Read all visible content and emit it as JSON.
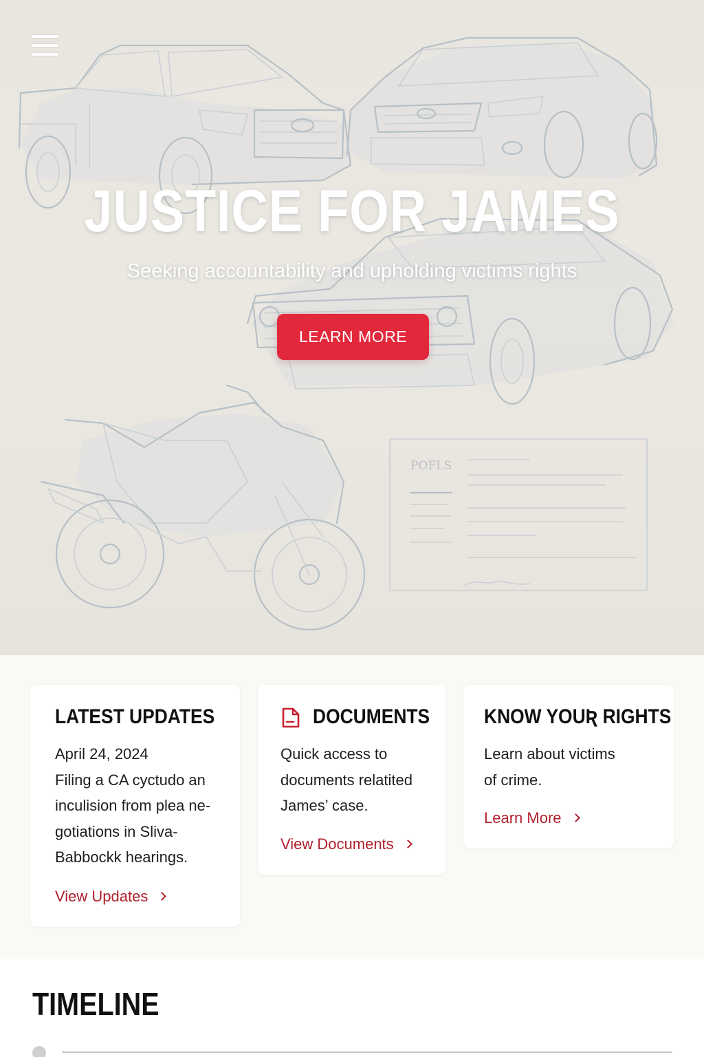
{
  "hero": {
    "title": "JUSTICE FOR JAMES",
    "subtitle": "Seeking accountability and upholding victims rights",
    "cta_label": "LEARN MORE",
    "doc_sketch_text": "POFLS"
  },
  "cards": {
    "updates": {
      "title": "LATEST UPDATES",
      "date": "April 24, 2024",
      "body": [
        "Filing a CA cyctudo an",
        "inculision from plea ne-",
        "gotiations in Sliva-",
        "Babbockk hearings."
      ],
      "link_label": "View Updates"
    },
    "documents": {
      "title": "DOCUMENTS",
      "body": [
        "Quick access to",
        "documents relatited",
        "James’ case."
      ],
      "link_label": "View Documents"
    },
    "rights": {
      "title": "KNOW YOUƦ RIGHTS",
      "body": [
        "Learn about victims",
        "of crime."
      ],
      "link_label": "Learn More"
    }
  },
  "timeline": {
    "title": "TIMELINE"
  },
  "colors": {
    "accent": "#e3283b",
    "link": "#b01f2b",
    "hero_bg": "#e9e6df",
    "sketch": "#b7c0c6"
  },
  "icons": {
    "menu": "hamburger-menu-icon",
    "documents": "document-icon",
    "link_arrow": "chevron-right-icon"
  }
}
